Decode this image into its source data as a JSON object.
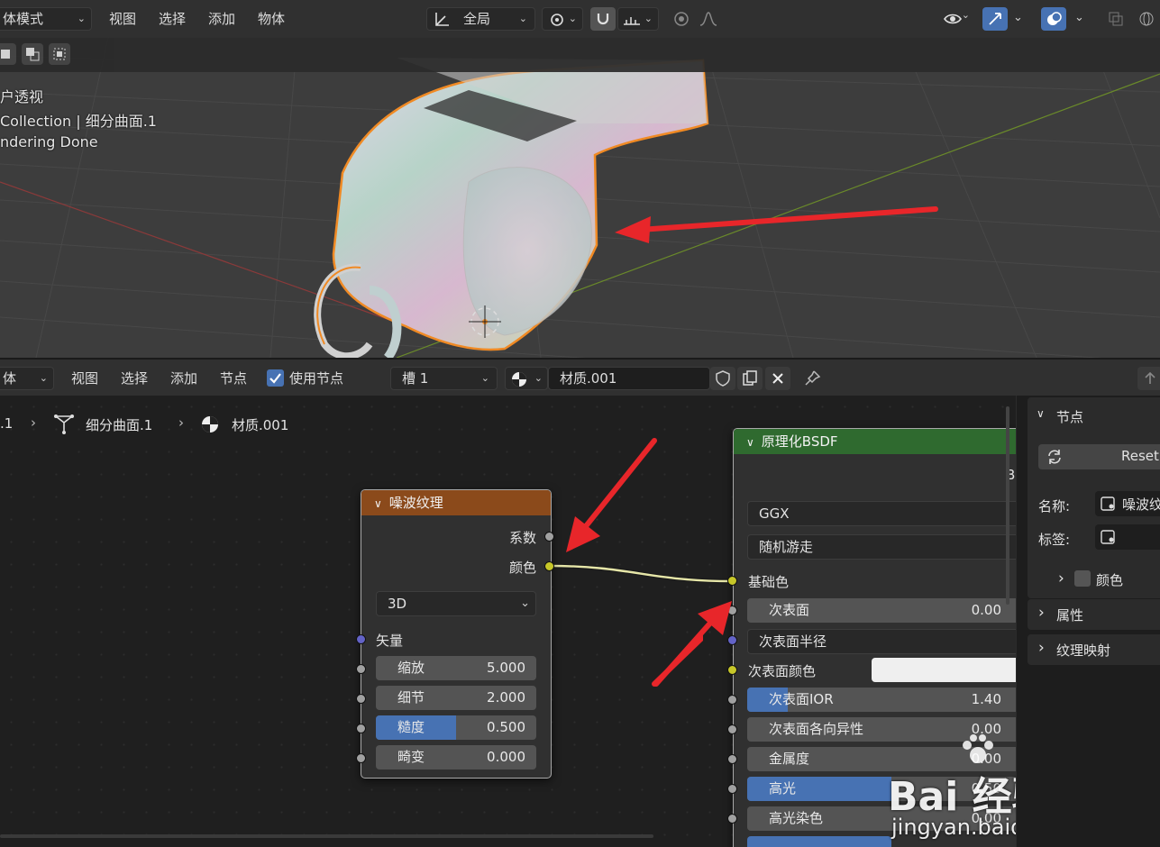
{
  "viewport_header": {
    "mode": "体模式",
    "menus": [
      "视图",
      "选择",
      "添加",
      "物体"
    ],
    "transform_orientation": "全局"
  },
  "viewport_overlay": {
    "view_name": "户透视",
    "collection": "Collection | 细分曲面.1",
    "status": "ndering Done"
  },
  "node_header": {
    "editor_type": "体",
    "menus": [
      "视图",
      "选择",
      "添加",
      "节点"
    ],
    "use_nodes_label": "使用节点",
    "use_nodes_checked": true,
    "slot": "槽 1",
    "material": "材质.001"
  },
  "breadcrumb": {
    "items": [
      ".1",
      "细分曲面.1",
      "材质.001"
    ]
  },
  "noise_node": {
    "title": "噪波纹理",
    "outputs": [
      "系数",
      "颜色"
    ],
    "dimensions": "3D",
    "vector_label": "矢量",
    "params": [
      {
        "label": "缩放",
        "value": "5.000",
        "fill": 0
      },
      {
        "label": "细节",
        "value": "2.000",
        "fill": 0
      },
      {
        "label": "糙度",
        "value": "0.500",
        "fill": 0.5
      },
      {
        "label": "畸变",
        "value": "0.000",
        "fill": 0
      }
    ]
  },
  "bsdf_node": {
    "title": "原理化BSDF",
    "output_letter": "B",
    "distribution": "GGX",
    "subsurface_method": "随机游走",
    "base_color_label": "基础色",
    "subsurface": {
      "label": "次表面",
      "value": "0.00",
      "fill": 0
    },
    "subsurface_radius": "次表面半径",
    "subsurface_color": "次表面颜色",
    "subsurface_ior": {
      "label": "次表面IOR",
      "value": "1.40",
      "fill": 0.14
    },
    "subsurface_aniso": {
      "label": "次表面各向异性",
      "value": "0.00",
      "fill": 0
    },
    "metallic": {
      "label": "金属度",
      "value": "0.00",
      "fill": 0
    },
    "specular": {
      "label": "高光",
      "value": "0.50",
      "fill": 0.5
    },
    "specular_tint": {
      "label": "高光染色",
      "value": "0.00",
      "fill": 0
    }
  },
  "sidebar": {
    "node_panel": "节点",
    "reset": "Reset",
    "name_label": "名称:",
    "name_value": "噪波纹",
    "label_label": "标签:",
    "color_label": "颜色",
    "properties": "属性",
    "texture_mapping": "纹理映射"
  },
  "watermark": {
    "brand": "Bai 经验",
    "url": "jingyan.baidu.com"
  },
  "colors": {
    "accent": "#4772b3",
    "noise_header": "#8b4a1b",
    "bsdf_header": "#2f6a2f",
    "annotation_arrow": "#e8262a",
    "selection_outline": "#f08a24"
  }
}
